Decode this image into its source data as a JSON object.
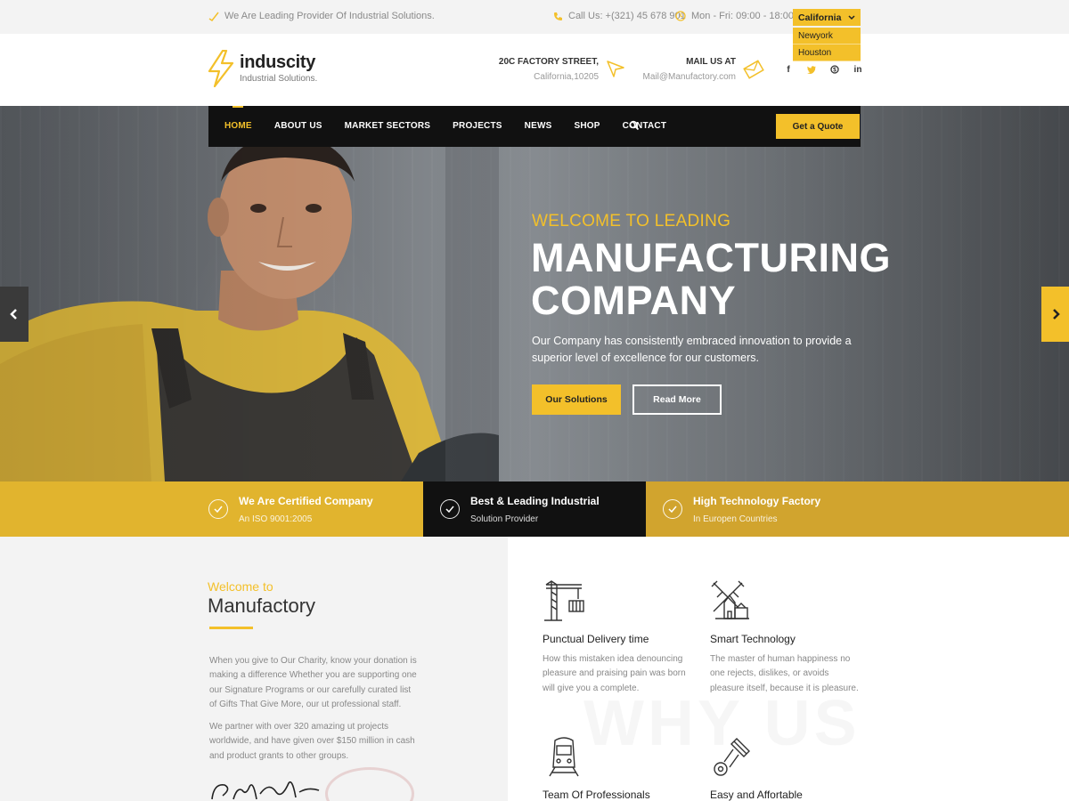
{
  "topbar": {
    "tagline": "We Are Leading Provider Of Industrial Solutions.",
    "phone": "Call Us: +(321) 45 678 901",
    "hours": "Mon - Fri: 09:00 - 18:00",
    "city_selected": "California",
    "city_options": [
      "Newyork",
      "Houston"
    ]
  },
  "header": {
    "logo_name": "induscity",
    "logo_tagline": "Industrial Solutions.",
    "address_title": "20C FACTORY STREET,",
    "address_sub": "California,10205",
    "mail_title": "MAIL US AT",
    "mail_sub": "Mail@Manufactory.com",
    "social": [
      "facebook-icon",
      "twitter-icon",
      "skype-icon",
      "linkedin-icon"
    ]
  },
  "nav": {
    "items": [
      "HOME",
      "ABOUT US",
      "MARKET SECTORS",
      "PROJECTS",
      "NEWS",
      "SHOP",
      "CONTACT"
    ],
    "active": "HOME",
    "quote": "Get a Quote"
  },
  "hero": {
    "welcome": "WELCOME TO LEADING",
    "line1": "MANUFACTURING",
    "line2": "COMPANY",
    "desc": "Our Company has consistently embraced innovation to provide a superior level of excellence for our customers.",
    "btn_solutions": "Our Solutions",
    "btn_read": "Read More"
  },
  "features": [
    {
      "title": "We Are Certified Company",
      "sub": "An ISO 9001:2005"
    },
    {
      "title": "Best & Leading Industrial",
      "sub": "Solution Provider"
    },
    {
      "title": "High Technology Factory",
      "sub": "In Europen Countries"
    }
  ],
  "about": {
    "welcome_to": "Welcome to",
    "title": "Manufactory",
    "para1": "When you give to Our Charity, know your donation is making a difference Whether you are supporting one our Signature Programs or our carefully curated list of Gifts That Give More, our ut professional staff.",
    "para2": "We partner with over 320 amazing ut projects worldwide, and have given over $150 million in cash and product grants to other groups."
  },
  "why": {
    "watermark": "WHY US",
    "services": [
      {
        "title": "Punctual Delivery time",
        "desc": "How this mistaken idea denouncing pleasure and praising pain was born will give you a complete.",
        "icon": "crane-icon"
      },
      {
        "title": "Smart Technology",
        "desc": "The master of human happiness no one rejects, dislikes, or avoids pleasure itself, because it is pleasure.",
        "icon": "windmill-icon"
      },
      {
        "title": "Team Of Professionals",
        "desc": "",
        "icon": "train-icon"
      },
      {
        "title": "Easy and Affortable",
        "desc": "",
        "icon": "tools-icon"
      }
    ]
  },
  "colors": {
    "accent": "#f3c02a",
    "dark": "#111111"
  }
}
